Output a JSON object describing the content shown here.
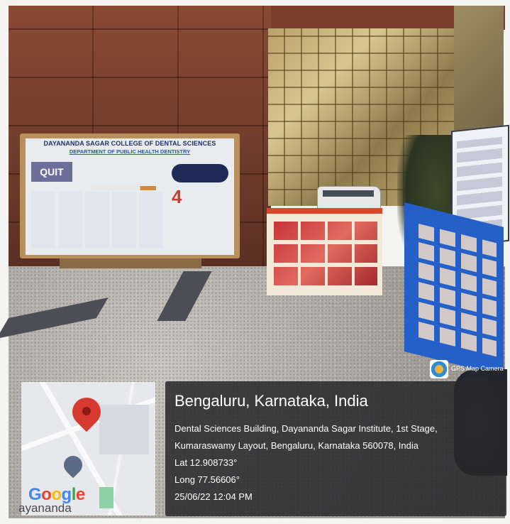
{
  "overlay": {
    "location_title": "Bengaluru, Karnataka, India",
    "address_line1": "Dental Sciences Building, Dayananda Sagar Institute, 1st Stage,",
    "address_line2": "Kumaraswamy Layout, Bengaluru, Karnataka 560078, India",
    "latitude": "Lat 12.908733°",
    "longitude": "Long 77.56606°",
    "datetime": "25/06/22 12:04 PM",
    "app_name": "GPS Map Camera",
    "map_brand": "Google",
    "map_place_fragment": "ayananda"
  },
  "scene": {
    "poster_title": "DAYANANDA SAGAR COLLEGE OF DENTAL SCIENCES",
    "poster_subtitle": "DEPARTMENT OF PUBLIC HEALTH DENTISTRY",
    "poster_quit": "QUIT",
    "poster_number": "4"
  },
  "colors": {
    "overlay_bg": "#28282a",
    "pin": "#d93a2f",
    "board_blue": "#2560c9",
    "poster_title": "#1f2f6a"
  }
}
